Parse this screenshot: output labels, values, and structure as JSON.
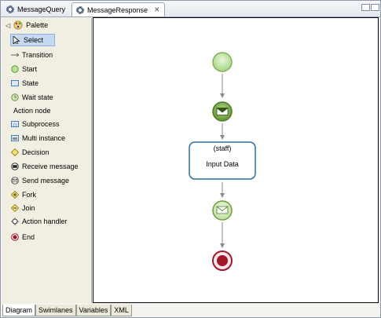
{
  "tabs": [
    {
      "label": "MessageQuery"
    },
    {
      "label": "MessageResponse",
      "close": "✕"
    }
  ],
  "palette": {
    "title": "Palette",
    "select": "Select",
    "transition": "Transition",
    "start": "Start",
    "state": "State",
    "wait_state": "Wait state",
    "action_node": "Action node",
    "subprocess": "Subprocess",
    "multi_instance": "Multi instance",
    "decision": "Decision",
    "receive_message": "Receive message",
    "send_message": "Send message",
    "fork": "Fork",
    "join": "Join",
    "action_handler": "Action handler",
    "end": "End"
  },
  "diagram": {
    "task_actor": "(staff)",
    "task_name": "Input Data"
  },
  "bottom_tabs": [
    "Diagram",
    "Swimlanes",
    "Variables",
    "XML"
  ],
  "colors": {
    "start_green": "#9fd37a",
    "message_green": "#6f9f3a",
    "end_red": "#a5162a",
    "task_border": "#2e6e9e"
  }
}
